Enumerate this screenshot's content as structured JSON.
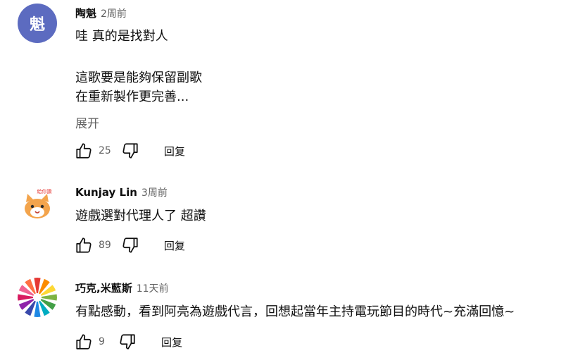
{
  "comments": [
    {
      "author": "陶魁",
      "time": "2周前",
      "avatar_letter": "魁",
      "lines": [
        "哇 真的是找對人",
        "這歌要是能夠保留副歌",
        "在重新製作更完善..."
      ],
      "expand_label": "展开",
      "likes": "25",
      "reply_label": "回复"
    },
    {
      "author": "Kunjay Lin",
      "time": "3周前",
      "avatar_text": "給你讚",
      "lines": [
        "遊戲選對代理人了 超讚"
      ],
      "likes": "89",
      "reply_label": "回复"
    },
    {
      "author": "巧克,米藍斯",
      "time": "11天前",
      "lines": [
        "有點感動，看到阿亮為遊戲代言，回想起當年主持電玩節目的時代~充滿回憶~"
      ],
      "likes": "9",
      "reply_label": "回复"
    }
  ],
  "colors": {
    "avatar_1": "#5c6bc0",
    "text_primary": "#0f0f0f",
    "text_secondary": "#606060"
  },
  "icons": [
    "like-icon",
    "dislike-icon"
  ]
}
